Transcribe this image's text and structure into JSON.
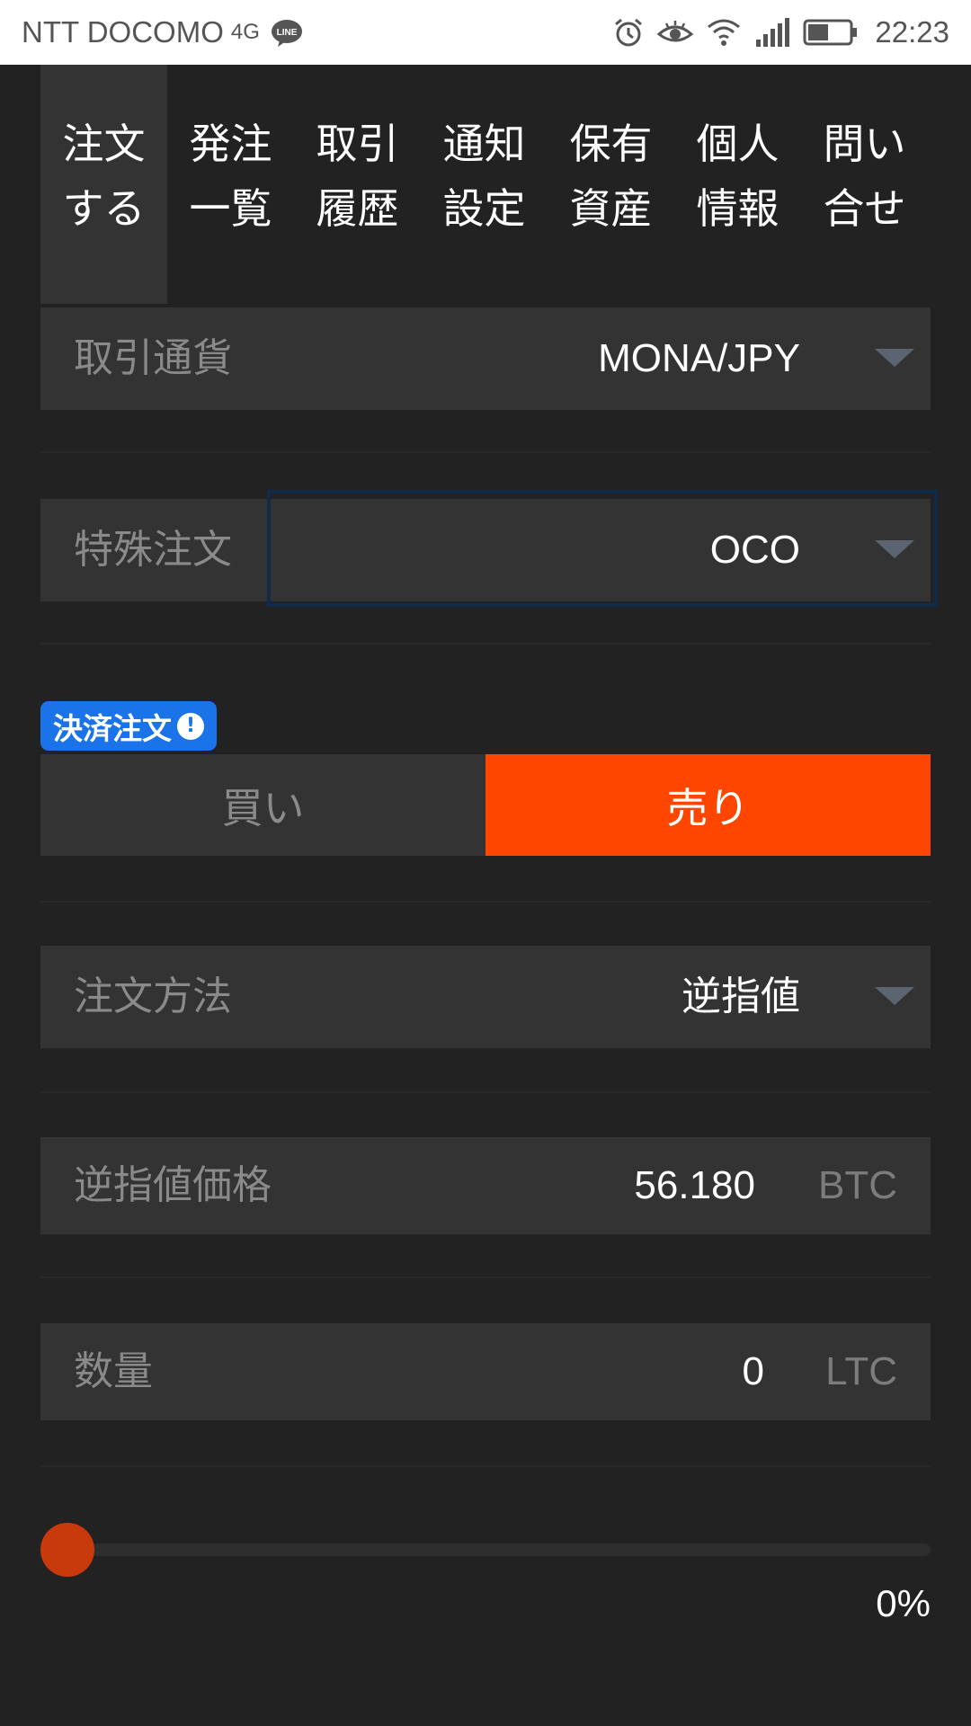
{
  "status_bar": {
    "carrier": "NTT DOCOMO",
    "network": "4G",
    "app_badge": "LINE",
    "time": "22:23",
    "icons": [
      "alarm-icon",
      "eye-icon",
      "wifi-icon",
      "signal-icon",
      "battery-icon"
    ]
  },
  "tabs": [
    {
      "line1": "注文",
      "line2": "する",
      "active": true
    },
    {
      "line1": "発注",
      "line2": "一覧",
      "active": false
    },
    {
      "line1": "取引",
      "line2": "履歴",
      "active": false
    },
    {
      "line1": "通知",
      "line2": "設定",
      "active": false
    },
    {
      "line1": "保有",
      "line2": "資産",
      "active": false
    },
    {
      "line1": "個人",
      "line2": "情報",
      "active": false
    },
    {
      "line1": "問い",
      "line2": "合せ",
      "active": false
    }
  ],
  "form": {
    "pair": {
      "label": "取引通貨",
      "value": "MONA/JPY"
    },
    "special_order": {
      "label": "特殊注文",
      "value": "OCO"
    },
    "settlement_badge": {
      "label": "決済注文",
      "info": "!"
    },
    "side": {
      "buy": "買い",
      "sell": "売り",
      "selected": "sell"
    },
    "order_method": {
      "label": "注文方法",
      "value": "逆指値"
    },
    "stop_price": {
      "label": "逆指値価格",
      "value": "56.180",
      "unit": "BTC"
    },
    "quantity": {
      "label": "数量",
      "value": "0",
      "unit": "LTC"
    },
    "slider": {
      "percent_label": "0%",
      "value": 0
    }
  },
  "colors": {
    "background": "#222222",
    "row": "#333333",
    "sell_accent": "#ff4600",
    "badge": "#1a73e8",
    "slider_thumb": "#c8390b"
  }
}
